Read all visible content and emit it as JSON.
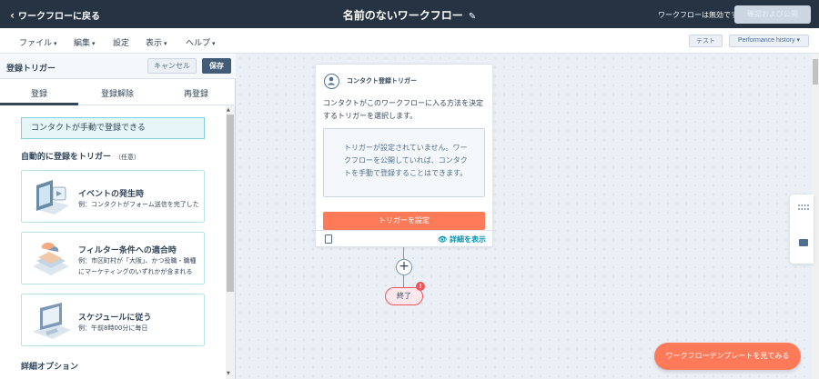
{
  "topbar": {
    "back_label": "ワークフローに戻る",
    "title": "名前のないワークフロー",
    "status": "ワークフローは無効です",
    "review_button": "確認および公開"
  },
  "menubar": {
    "items": [
      {
        "label": "ファイル",
        "has_caret": true
      },
      {
        "label": "編集",
        "has_caret": true
      },
      {
        "label": "設定",
        "has_caret": false
      },
      {
        "label": "表示",
        "has_caret": true
      },
      {
        "label": "ヘルプ",
        "has_caret": true
      }
    ],
    "test_button": "テスト",
    "performance_button": "Performance history"
  },
  "left_panel": {
    "title": "登録トリガー",
    "cancel_label": "キャンセル",
    "save_label": "保存",
    "tabs": [
      {
        "label": "登録",
        "active": true
      },
      {
        "label": "登録解除",
        "active": false
      },
      {
        "label": "再登録",
        "active": false
      }
    ],
    "manual_enroll": "コンタクトが手動で登録できる",
    "auto_section_title": "自動的に登録をトリガー",
    "auto_section_optional": "（任意）",
    "options": [
      {
        "title": "イベントの発生時",
        "desc": [
          "例：コンタクトがフォーム送信を完了した"
        ]
      },
      {
        "title": "フィルター条件への適合時",
        "desc": [
          "例：市区町村が「大阪」、かつ役職・職種",
          "にマーケティングのいずれかが含まれる"
        ]
      },
      {
        "title": "スケジュールに従う",
        "desc": [
          "例：午前8時00分に毎日"
        ]
      }
    ],
    "advanced_title": "詳細オプション"
  },
  "canvas": {
    "trigger_card": {
      "title": "コンタクト登録トリガー",
      "description": "コンタクトがこのワークフローに入る方法を決定するトリガーを選択します。",
      "empty_message": "トリガーが設定されていません。ワークフローを公開していれば、コンタクトを手動で登録することはできます。",
      "set_button": "トリガーを設定",
      "details_link": "詳細を表示"
    },
    "plus_label": "+",
    "end_label": "終了",
    "alert_badge": "!",
    "template_button": "ワークフローテンプレートを見てみる"
  },
  "colors": {
    "topbar_bg": "#253342",
    "accent_orange": "#ff7a59",
    "teal_link": "#0091ae",
    "save_button_bg": "#425b76",
    "end_node_border": "#f2545b"
  },
  "icons": [
    "chevron-left-icon",
    "pencil-icon",
    "caret-down-icon",
    "user-icon",
    "clipboard-icon",
    "eye-icon",
    "grid-icon",
    "chat-icon"
  ]
}
